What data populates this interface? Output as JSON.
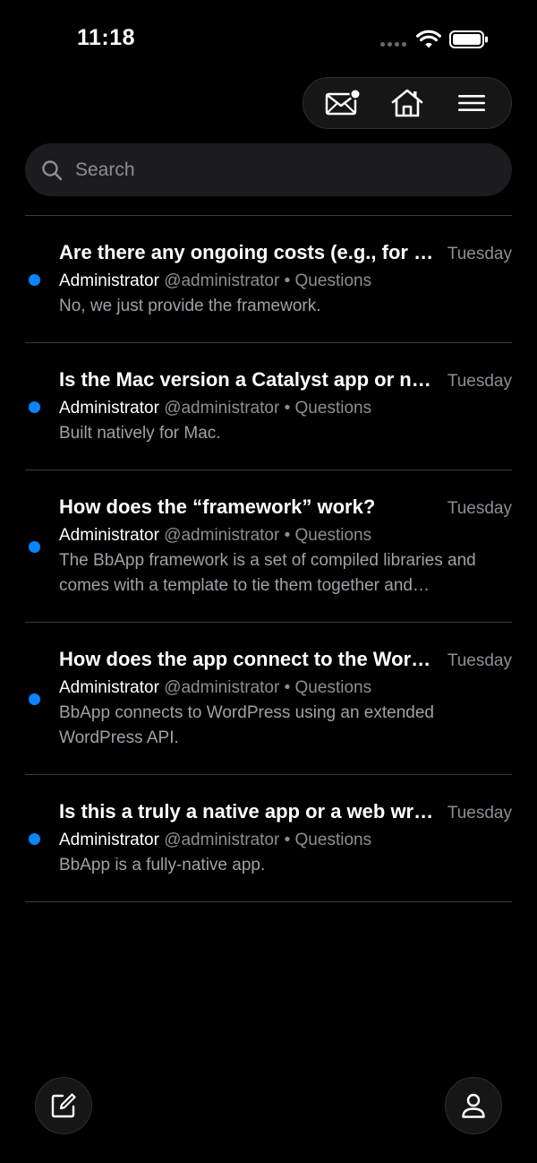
{
  "status_bar": {
    "time": "11:18"
  },
  "toolbar": {
    "icons": [
      "mail-notification-icon",
      "home-icon",
      "menu-icon"
    ]
  },
  "search": {
    "placeholder": "Search",
    "value": ""
  },
  "colors": {
    "background": "#000000",
    "accent_unread": "#0a84ff",
    "secondary_text": "#8e8e93",
    "surface": "#1c1c1e"
  },
  "topics": [
    {
      "title": "Are there any ongoing costs (e.g., for hosting, updates, etc.)?",
      "date": "Tuesday",
      "author": "Administrator",
      "handle": "@administrator",
      "separator": "•",
      "forum": "Questions",
      "excerpt": "No, we just provide the framework.",
      "unread": true
    },
    {
      "title": "Is the Mac version a Catalyst app or native?",
      "date": "Tuesday",
      "author": "Administrator",
      "handle": "@administrator",
      "separator": "•",
      "forum": "Questions",
      "excerpt": "Built natively for Mac.",
      "unread": true
    },
    {
      "title": "How does the “framework” work?",
      "date": "Tuesday",
      "author": "Administrator",
      "handle": "@administrator",
      "separator": "•",
      "forum": "Questions",
      "excerpt": "The BbApp framework is a set of compiled libraries and comes with a template to tie them together and…",
      "unread": true
    },
    {
      "title": "How does the app connect to the WordPress site?",
      "date": "Tuesday",
      "author": "Administrator",
      "handle": "@administrator",
      "separator": "•",
      "forum": "Questions",
      "excerpt": "BbApp connects to WordPress using an extended WordPress API.",
      "unread": true
    },
    {
      "title": "Is this a truly a native app or a web wrapper?",
      "date": "Tuesday",
      "author": "Administrator",
      "handle": "@administrator",
      "separator": "•",
      "forum": "Questions",
      "excerpt": "BbApp is a fully-native app.",
      "unread": true
    }
  ],
  "bottom_actions": {
    "icons": [
      "compose-icon",
      "profile-icon"
    ]
  }
}
